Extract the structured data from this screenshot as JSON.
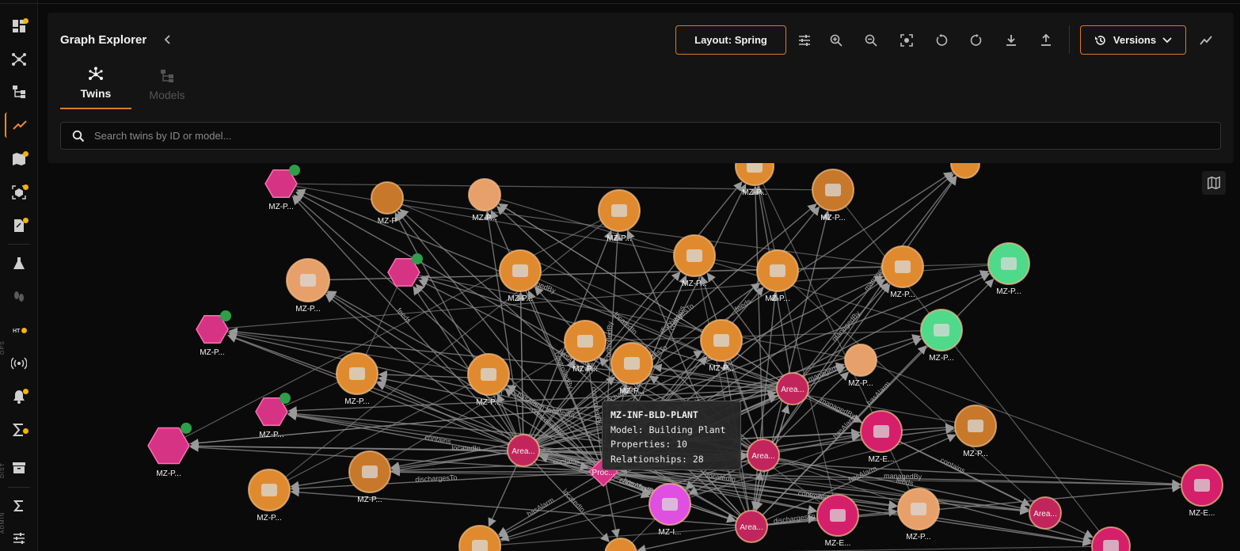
{
  "colors": {
    "accent": "#e07a1f",
    "badge_dot": "#f4b400",
    "edge": "#8f8f8f"
  },
  "sidebar": {
    "items": [
      {
        "icon": "dashboard-icon",
        "dot": true
      },
      {
        "icon": "graph-network-icon",
        "dot": false
      },
      {
        "icon": "hierarchy-icon",
        "dot": false
      },
      {
        "icon": "trending-icon",
        "dot": false,
        "active": true
      },
      {
        "icon": "map-icon",
        "dot": true
      },
      {
        "icon": "cube-scan-icon",
        "dot": true
      },
      {
        "icon": "document-edit-icon",
        "dot": true
      },
      {
        "icon": "flask-icon",
        "dot": false
      },
      {
        "icon": "footprint-icon",
        "dot": false
      },
      {
        "icon": "http-icon",
        "dot": true
      },
      {
        "icon": "signal-icon",
        "dot": false
      },
      {
        "icon": "alarm-icon",
        "dot": true
      },
      {
        "icon": "sigma-check-icon",
        "dot": true
      },
      {
        "icon": "archive-icon",
        "dot": false
      },
      {
        "icon": "sigma-icon",
        "dot": false
      },
      {
        "icon": "sliders-icon",
        "dot": false
      }
    ],
    "sections": [
      "OPS",
      "DIST",
      "ADMIN"
    ]
  },
  "header": {
    "title": "Graph Explorer",
    "layout_label": "Layout: Spring",
    "versions_label": "Versions",
    "tools": [
      "filter-sliders-icon",
      "zoom-in-icon",
      "zoom-out-icon",
      "fit-view-icon",
      "rotate-left-icon",
      "refresh-icon",
      "download-icon",
      "upload-icon"
    ]
  },
  "tabs": [
    {
      "label": "Twins",
      "active": true
    },
    {
      "label": "Models",
      "active": false
    }
  ],
  "search": {
    "placeholder": "Search twins by ID or model..."
  },
  "tooltip": {
    "title": "MZ-INF-BLD-PLANT",
    "model": "Model: Building Plant",
    "properties": "Properties: 10",
    "relationships": "Relationships: 28"
  },
  "graph": {
    "edge_labels": [
      "feeds",
      "contains",
      "locatedIn",
      "managedBy",
      "dischargesTo",
      "controlledBy",
      "hasAlarm"
    ],
    "node_label": "MZ-P...",
    "nodes": [
      {
        "label": "MZ-P...",
        "kind": "hex",
        "color": "#d63384"
      },
      {
        "label": "MZ-P",
        "kind": "circle",
        "color": "#c8782a"
      },
      {
        "label": "MZ-P...",
        "kind": "circle",
        "color": "#e8a06a"
      },
      {
        "label": "MZ-P...",
        "kind": "circle",
        "color": "#e08a2f"
      },
      {
        "label": "MZ-P...",
        "kind": "circle",
        "color": "#c8782a"
      },
      {
        "label": "MZ-P...",
        "kind": "circle",
        "color": "#e08a2f"
      },
      {
        "label": "Area...",
        "kind": "circle",
        "color": "#c2255c"
      },
      {
        "label": "Proc...",
        "kind": "diamond",
        "color": "#d63384"
      },
      {
        "label": "MZ-E...",
        "kind": "circle",
        "color": "#d61f6b"
      },
      {
        "label": "MZ-I...",
        "kind": "circle",
        "color": "#e050e0"
      },
      {
        "label": "MZ-P...",
        "kind": "circle",
        "color": "#4fd98a"
      }
    ]
  }
}
